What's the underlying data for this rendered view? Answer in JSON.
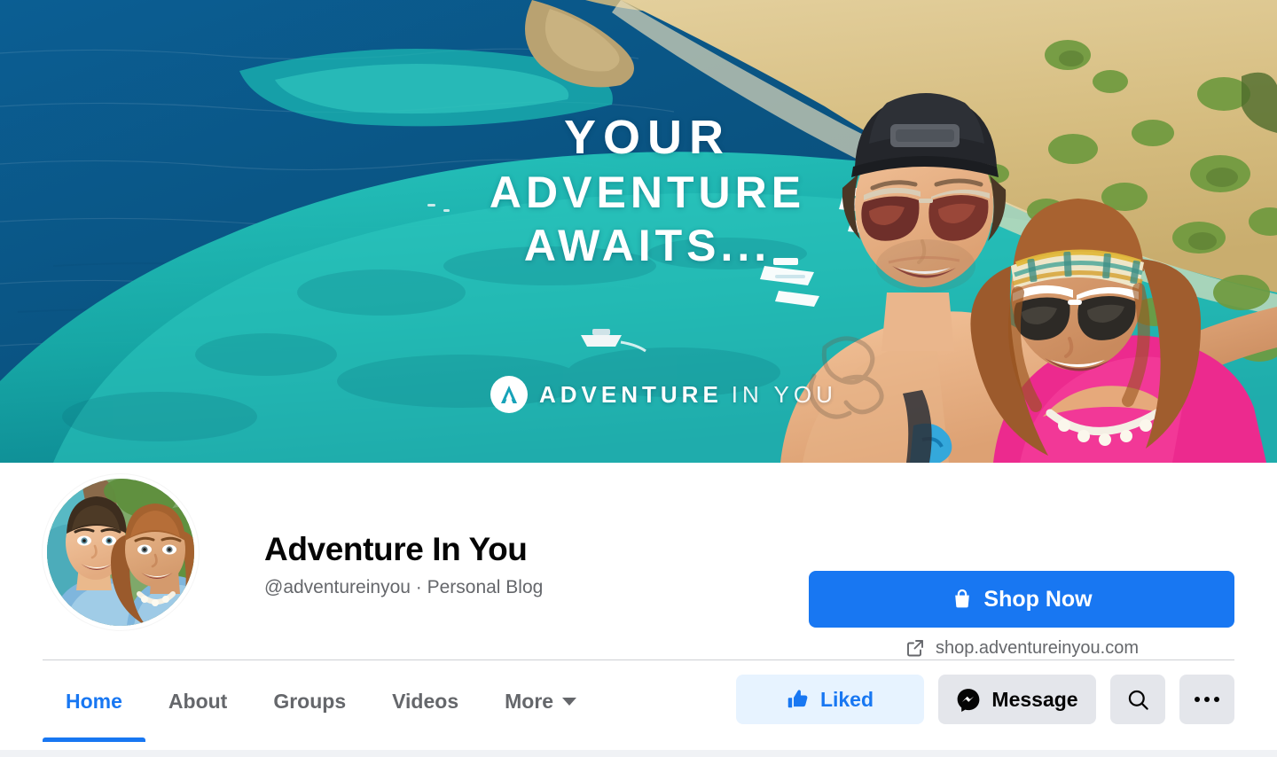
{
  "cover": {
    "headline_line1": "YOUR",
    "headline_line2": "ADVENTURE",
    "headline_line3": "AWAITS...",
    "brand_bold": "ADVENTURE",
    "brand_light": "IN YOU",
    "brand_monogram": "A",
    "colors": {
      "deep_water": "#0a5b8e",
      "turquoise": "#1fb4ae",
      "shallow": "#58d2c9",
      "sand": "#d9c084",
      "foliage": "#6f9a3f",
      "pink_top": "#ec2a8e"
    }
  },
  "identity": {
    "page_name": "Adventure In You",
    "subtitle": "@adventureinyou · Personal Blog",
    "handle": "@adventureinyou",
    "category": "Personal Blog"
  },
  "cta": {
    "shop_label": "Shop Now",
    "shop_url": "shop.adventureinyou.com",
    "accent": "#1877f2"
  },
  "nav": {
    "tabs": [
      {
        "label": "Home",
        "active": true
      },
      {
        "label": "About",
        "active": false
      },
      {
        "label": "Groups",
        "active": false
      },
      {
        "label": "Videos",
        "active": false
      },
      {
        "label": "More",
        "active": false,
        "has_caret": true
      }
    ]
  },
  "actions": {
    "liked_label": "Liked",
    "message_label": "Message",
    "search_label": "",
    "more_label": ""
  }
}
